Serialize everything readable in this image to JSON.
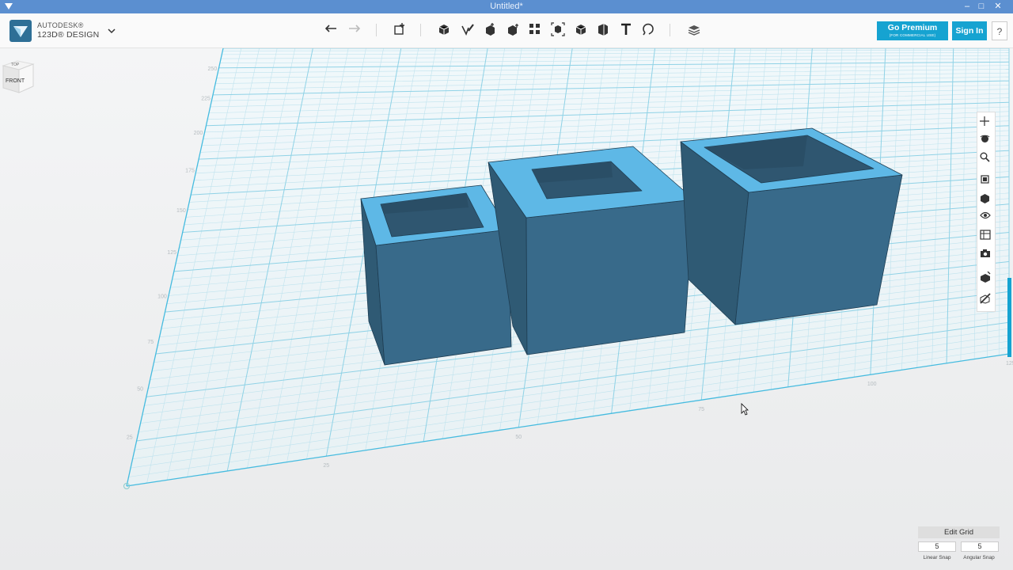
{
  "window": {
    "title": "Untitled*",
    "minimize": "–",
    "maximize": "□",
    "close": "✕"
  },
  "brand": {
    "company": "AUTODESK®",
    "product": "123D® DESIGN"
  },
  "toolbar": {
    "tools": [
      "undo-icon",
      "redo-icon",
      "transform-icon",
      "primitives-icon",
      "sketch-icon",
      "construct-icon",
      "modify-icon",
      "pattern-icon",
      "grouping-icon",
      "combine-icon",
      "measure-icon",
      "text-icon",
      "snap-icon",
      "material-icon"
    ]
  },
  "premium": {
    "label": "Go Premium",
    "sublabel": "(FOR COMMERCIAL USE)"
  },
  "signin": "Sign In",
  "help": "?",
  "viewcube": {
    "top": "TOP",
    "front": "FRONT"
  },
  "navbar": {
    "tools": [
      "pan-icon",
      "orbit-icon",
      "zoom-icon",
      "fit-icon",
      "views-icon",
      "visibility-icon",
      "materials-outline-icon",
      "screenshot-icon",
      "snap-grid-icon",
      "edit-icon"
    ]
  },
  "grid": {
    "x_ticks": [
      "25",
      "50",
      "75",
      "100",
      "125"
    ],
    "y_ticks": [
      "25",
      "50",
      "75",
      "100",
      "125",
      "150",
      "175",
      "200",
      "225",
      "250"
    ]
  },
  "edit_grid": {
    "label": "Edit Grid",
    "linear_snap": {
      "value": "5",
      "label": "Linear Snap"
    },
    "angular_snap": {
      "value": "5",
      "label": "Angular Snap"
    }
  },
  "colors": {
    "accent": "#16a3d1",
    "model_top": "#5eb8e6",
    "model_side": "#386a8a",
    "model_inner": "#2f5670",
    "grid": "#8fd2e6"
  }
}
